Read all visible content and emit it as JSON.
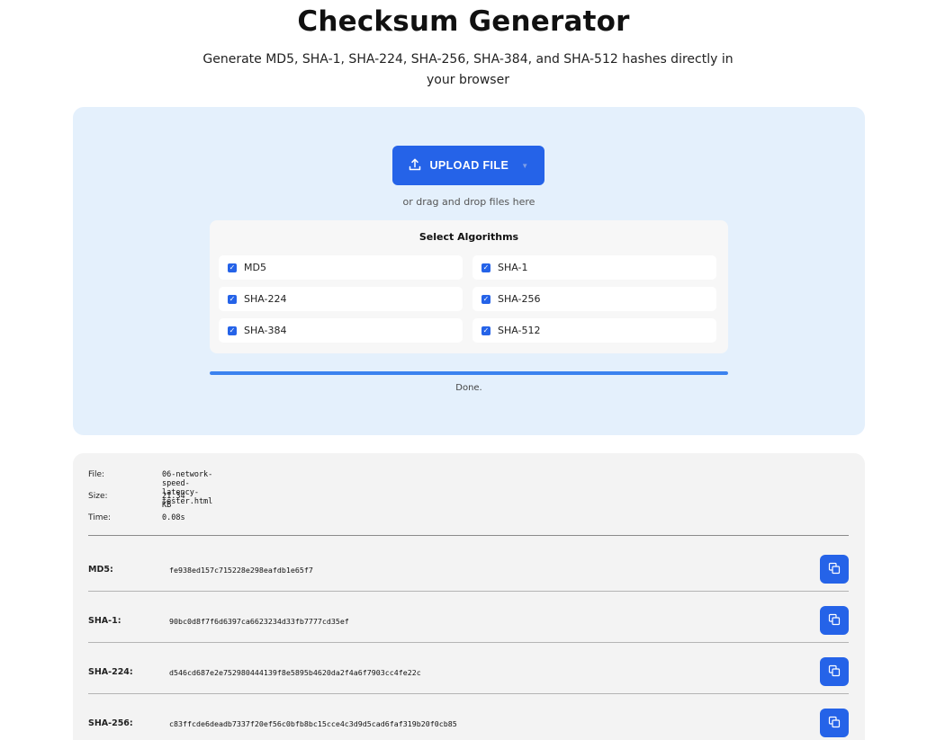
{
  "header": {
    "title": "Checksum Generator",
    "subtitle": "Generate MD5, SHA-1, SHA-224, SHA-256, SHA-384, and SHA-512 hashes directly in your browser"
  },
  "upload": {
    "button_label": "UPLOAD FILE",
    "button_icon": "upload-icon",
    "drop_hint": "or drag and drop files here"
  },
  "algorithms": {
    "title": "Select Algorithms",
    "items": [
      {
        "label": "MD5",
        "checked": true
      },
      {
        "label": "SHA-1",
        "checked": true
      },
      {
        "label": "SHA-224",
        "checked": true
      },
      {
        "label": "SHA-256",
        "checked": true
      },
      {
        "label": "SHA-384",
        "checked": true
      },
      {
        "label": "SHA-512",
        "checked": true
      }
    ]
  },
  "progress": {
    "percent": 100,
    "status": "Done."
  },
  "results": {
    "file_label": "File:",
    "file_value": "06-network-speed-latency-tester.html",
    "size_label": "Size:",
    "size_value": "21.34 KB",
    "time_label": "Time:",
    "time_value": "0.08s",
    "hashes": [
      {
        "label": "MD5:",
        "value": "fe938ed157c715228e298eafdb1e65f7"
      },
      {
        "label": "SHA-1:",
        "value": "90bc0d8f7f6d6397ca6623234d33fb7777cd35ef"
      },
      {
        "label": "SHA-224:",
        "value": "d546cd687e2e752980444139f8e5895b4620da2f4a6f7903cc4fe22c"
      },
      {
        "label": "SHA-256:",
        "value": "c83ffcde6deadb7337f20ef56c0bfb8bc15cce4c3d9d5cad6faf319b20f0cb85"
      }
    ],
    "copy_icon": "copy-icon"
  },
  "colors": {
    "accent": "#2563e8",
    "upload_panel_bg": "#e4f0fc",
    "results_panel_bg": "#f3f3f3",
    "progress_fill": "#3b82ef"
  }
}
